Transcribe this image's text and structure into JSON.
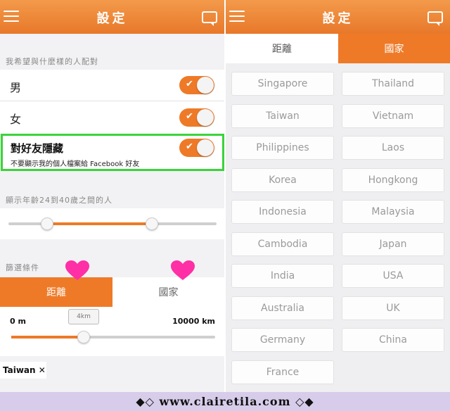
{
  "left_screen": {
    "nav_title": "設定",
    "match_header": "我希望與什麼樣的人配對",
    "rows": [
      {
        "label": "男"
      },
      {
        "label": "女"
      }
    ],
    "hide_friends": {
      "title": "對好友隱藏",
      "subtitle": "不要顯示我的個人檔案給 Facebook 好友"
    },
    "age_header": "顯示年齡24到40歲之間的人",
    "filter_header": "篩選條件",
    "tabs": {
      "distance": "距離",
      "country": "國家"
    },
    "distance": {
      "min": "0 m",
      "max": "10000 km",
      "bubble": "4km"
    },
    "selected_tag": "Taiwan ✕"
  },
  "right_screen": {
    "nav_title": "設定",
    "tabs": {
      "distance": "距離",
      "country": "國家"
    },
    "countries": [
      "Singapore",
      "Thailand",
      "Taiwan",
      "Vietnam",
      "Philippines",
      "Laos",
      "Korea",
      "Hongkong",
      "Indonesia",
      "Malaysia",
      "Cambodia",
      "Japan",
      "India",
      "USA",
      "Australia",
      "UK",
      "Germany",
      "China",
      "France"
    ]
  },
  "footer": {
    "text": "◆◇ www.clairetila.com ◇◆"
  },
  "colors": {
    "accent": "#ee7a28",
    "highlight": "#3ad33a",
    "heart": "#ff2fa6",
    "footer_bg": "#d7cdea"
  }
}
